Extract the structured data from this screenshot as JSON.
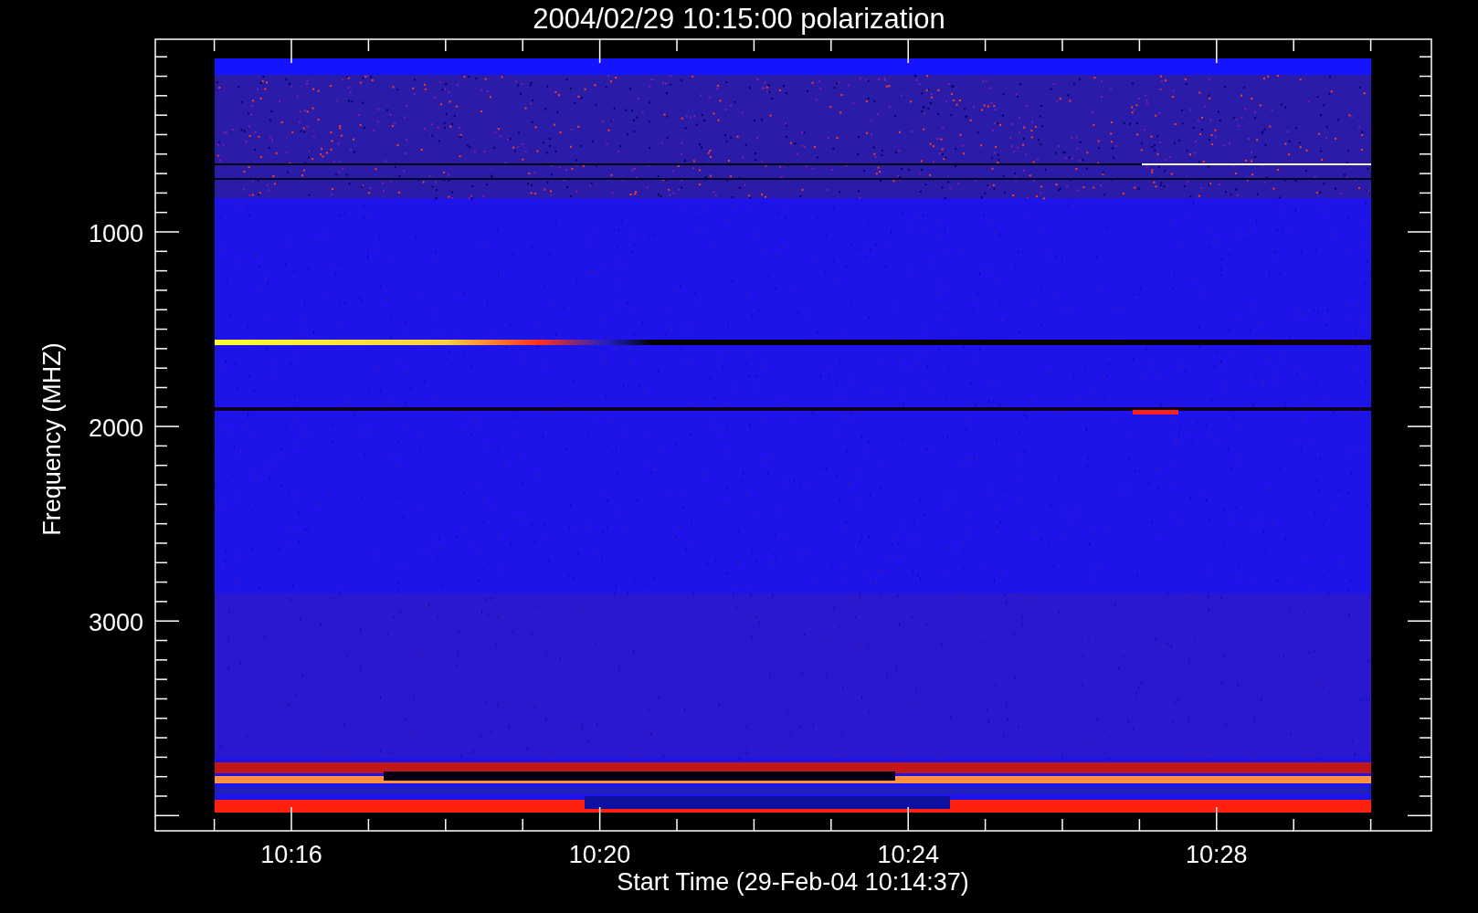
{
  "title": "2004/02/29 10:15:00 polarization",
  "plot": {
    "ylabel": "Frequency (MHZ)",
    "xlabel": "Start Time (29-Feb-04 10:14:37)",
    "yticks": [
      "1000",
      "2000",
      "3000"
    ],
    "xticks": [
      "10:16",
      "10:20",
      "10:24",
      "10:28"
    ]
  }
}
